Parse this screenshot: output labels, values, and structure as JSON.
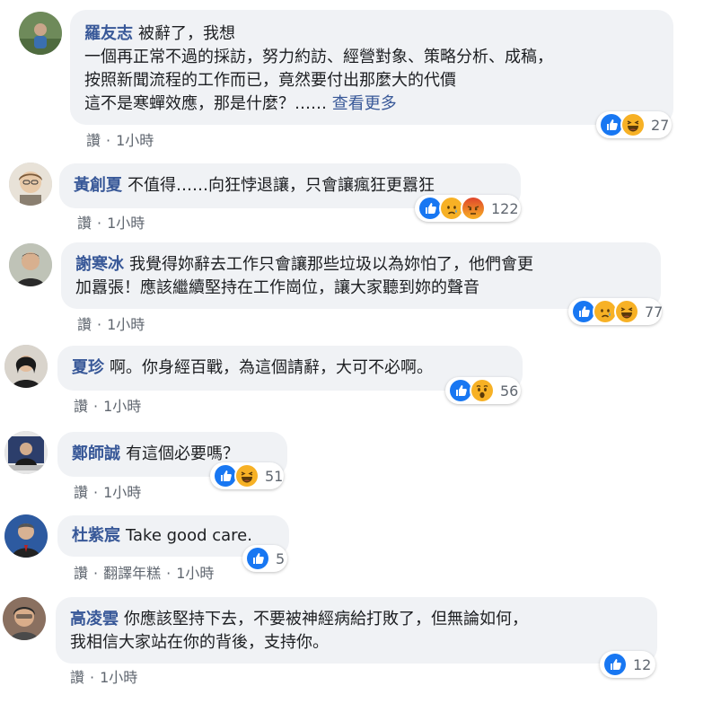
{
  "comments": [
    {
      "author": "羅友志",
      "text": "被辭了，我想\n一個再正常不過的採訪，努力約訪、經營對象、策略分析、成稿，\n按照新聞流程的工作而已，竟然要付出那麼大的代價\n這不是寒蟬效應，那是什麼？……",
      "see_more": "查看更多",
      "like": "讚",
      "translate": "",
      "time": "1小時",
      "reactions": [
        "like",
        "haha"
      ],
      "count": "27"
    },
    {
      "author": "黃創夏",
      "text": "不值得……向狂悖退讓，只會讓瘋狂更囂狂",
      "like": "讚",
      "time": "1小時",
      "reactions": [
        "like",
        "sad",
        "angry"
      ],
      "count": "122"
    },
    {
      "author": "謝寒冰",
      "text": "我覺得妳辭去工作只會讓那些垃圾以為妳怕了，他們會更\n加囂張！應該繼續堅持在工作崗位，讓大家聽到妳的聲音",
      "like": "讚",
      "time": "1小時",
      "reactions": [
        "like",
        "sad",
        "haha"
      ],
      "count": "77"
    },
    {
      "author": "夏珍",
      "text": "啊。你身經百戰，為這個請辭，大可不必啊。",
      "like": "讚",
      "time": "1小時",
      "reactions": [
        "like",
        "wow"
      ],
      "count": "56"
    },
    {
      "author": "鄭師誠",
      "text": "有這個必要嗎？",
      "like": "讚",
      "time": "1小時",
      "reactions": [
        "like",
        "haha"
      ],
      "count": "51"
    },
    {
      "author": "杜紫宸",
      "text": "Take good care.",
      "like": "讚",
      "translate": "翻譯年糕",
      "time": "1小時",
      "reactions": [
        "like"
      ],
      "count": "5"
    },
    {
      "author": "高凌雲",
      "text": "你應該堅持下去，不要被神經病給打敗了，但無論如何，\n我相信大家站在你的背後，支持你。",
      "like": "讚",
      "time": "1小時",
      "reactions": [
        "like"
      ],
      "count": "12"
    }
  ],
  "colors": {
    "author": "#385898",
    "bubble": "#f0f2f5",
    "like": "#1877f2",
    "haha": "#f7b125",
    "angry": "#e9710f"
  }
}
